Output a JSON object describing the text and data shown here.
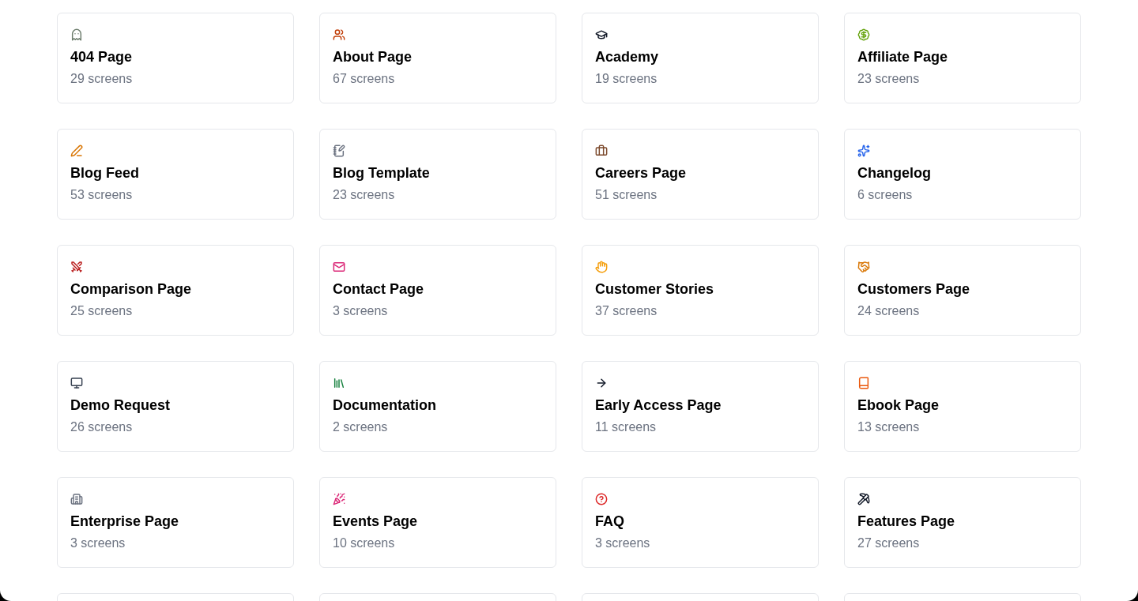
{
  "cards": [
    {
      "kind": "alien",
      "title": "404 Page",
      "count": "29 screens"
    },
    {
      "kind": "people",
      "title": "About Page",
      "count": "67 screens"
    },
    {
      "kind": "cap",
      "title": "Academy",
      "count": "19 screens"
    },
    {
      "kind": "money",
      "title": "Affiliate Page",
      "count": "23 screens"
    },
    {
      "kind": "pen",
      "title": "Blog Feed",
      "count": "53 screens"
    },
    {
      "kind": "memo",
      "title": "Blog Template",
      "count": "23 screens"
    },
    {
      "kind": "briefcase",
      "title": "Careers Page",
      "count": "51 screens"
    },
    {
      "kind": "new",
      "title": "Changelog",
      "count": "6 screens"
    },
    {
      "kind": "glove",
      "title": "Comparison Page",
      "count": "25 screens"
    },
    {
      "kind": "letter",
      "title": "Contact Page",
      "count": "3 screens"
    },
    {
      "kind": "okhand",
      "title": "Customer Stories",
      "count": "37 screens"
    },
    {
      "kind": "handshake",
      "title": "Customers Page",
      "count": "24 screens"
    },
    {
      "kind": "computer",
      "title": "Demo Request",
      "count": "26 screens"
    },
    {
      "kind": "books",
      "title": "Documentation",
      "count": "2 screens"
    },
    {
      "kind": "soon",
      "title": "Early Access Page",
      "count": "11 screens"
    },
    {
      "kind": "book",
      "title": "Ebook Page",
      "count": "13 screens"
    },
    {
      "kind": "building",
      "title": "Enterprise Page",
      "count": "3 screens"
    },
    {
      "kind": "party",
      "title": "Events Page",
      "count": "10 screens"
    },
    {
      "kind": "question",
      "title": "FAQ",
      "count": "3 screens"
    },
    {
      "kind": "pick",
      "title": "Features Page",
      "count": "27 screens"
    }
  ]
}
